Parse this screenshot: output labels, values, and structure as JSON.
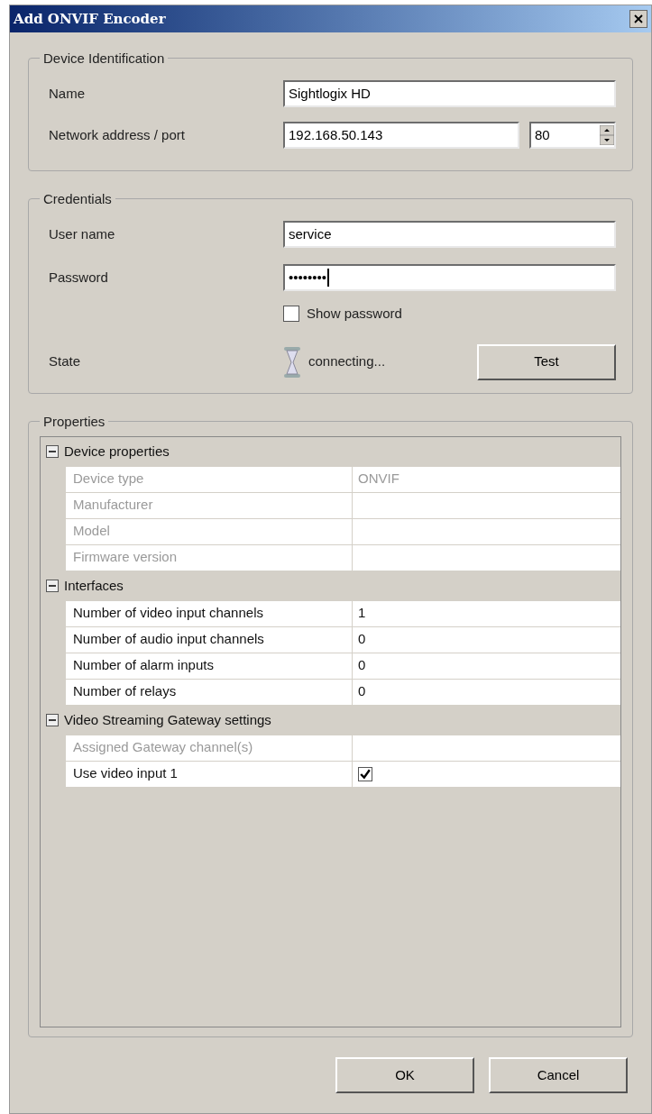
{
  "window": {
    "title": "Add ONVIF Encoder"
  },
  "device_identification": {
    "title": "Device Identification",
    "name_label": "Name",
    "name_value": "Sightlogix HD",
    "address_label": "Network address / port",
    "address_value": "192.168.50.143",
    "port_value": "80"
  },
  "credentials": {
    "title": "Credentials",
    "user_label": "User name",
    "user_value": "service",
    "password_label": "Password",
    "password_value": "••••••••",
    "show_password": {
      "label": "Show password",
      "checked": false
    },
    "state_label": "State",
    "state_value": "connecting...",
    "test_button": "Test"
  },
  "properties": {
    "title": "Properties",
    "categories": [
      {
        "name": "Device properties",
        "expanded": true,
        "rows": [
          {
            "name": "Device type",
            "value": "ONVIF",
            "disabled": true
          },
          {
            "name": "Manufacturer",
            "disabled": true
          },
          {
            "name": "Model",
            "disabled": true
          },
          {
            "name": "Firmware version",
            "disabled": true
          }
        ]
      },
      {
        "name": "Interfaces",
        "expanded": true,
        "rows": [
          {
            "name": "Number of video input channels",
            "value": "1",
            "disabled": false
          },
          {
            "name": "Number of audio input channels",
            "value": "0",
            "disabled": false
          },
          {
            "name": "Number of alarm inputs",
            "value": "0",
            "disabled": false
          },
          {
            "name": "Number of relays",
            "value": "0",
            "disabled": false
          }
        ]
      },
      {
        "name": "Video Streaming Gateway settings",
        "expanded": true,
        "rows": [
          {
            "name": "Assigned Gateway channel(s)",
            "disabled": true
          },
          {
            "name": "Use video input 1",
            "kind": "checkbox",
            "checked": true,
            "disabled": false
          }
        ]
      }
    ]
  },
  "buttons": [
    "OK",
    "Cancel"
  ]
}
